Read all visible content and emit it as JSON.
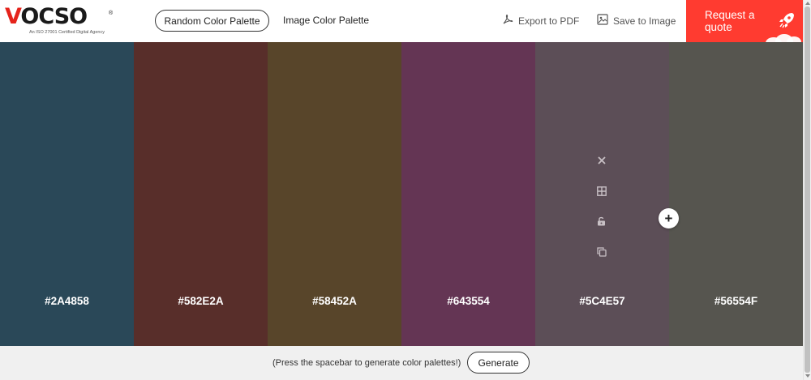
{
  "logo": {
    "wordmark_v": "V",
    "wordmark_rest": "OCSO",
    "registered": "®",
    "tagline": "An ISO 27001 Certified Digital Agency"
  },
  "nav": {
    "random_palette": "Random Color Palette",
    "image_palette": "Image Color Palette",
    "export_pdf": "Export to PDF",
    "save_image": "Save to Image",
    "request_quote": "Request a quote"
  },
  "palette": {
    "swatches": [
      {
        "hex": "#2A4858",
        "color": "#2A4858"
      },
      {
        "hex": "#582E2A",
        "color": "#582E2A"
      },
      {
        "hex": "#58452A",
        "color": "#58452A"
      },
      {
        "hex": "#643554",
        "color": "#643554"
      },
      {
        "hex": "#5C4E57",
        "color": "#5C4E57"
      },
      {
        "hex": "#56554F",
        "color": "#56554F"
      }
    ],
    "active_tools": [
      "close-icon",
      "grid-icon",
      "unlock-icon",
      "copy-icon"
    ],
    "add_symbol": "+"
  },
  "footer": {
    "hint": "(Press the spacebar to generate color palettes!)",
    "generate": "Generate"
  },
  "colors": {
    "accent": "#ff3b30",
    "footer_bg": "#f0f0f0"
  }
}
